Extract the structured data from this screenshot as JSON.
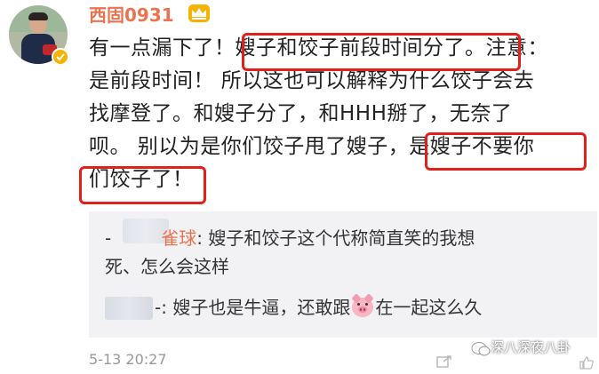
{
  "post": {
    "username": "西固0931",
    "lines": [
      "有一点漏下了！嫂子和饺子前段时间分了。注意：",
      "是前段时间！ 所以这也可以解释为什么饺子会去",
      "找摩登了。和嫂子分了，和HHH掰了，无奈了",
      "呗。 别以为是你们饺子甩了嫂子，是嫂子不要你",
      "们饺子了！"
    ],
    "timestamp": "5-13 20:27"
  },
  "quote": {
    "reply1_prefix": "-",
    "reply1_name": "雀球",
    "reply1_text": ": 嫂子和饺子这个代称简直笑的我想",
    "reply1_cont": "死、怎么会这样",
    "reply2_prefix": "-:",
    "reply2_text_a": " 嫂子也是牛逼，还敢跟",
    "reply2_text_b": "在一起这么久"
  },
  "watermark": {
    "text": "深八深夜八卦"
  },
  "icons": {
    "crown": "crown-icon",
    "verified": "verified-badge-icon",
    "pig": "pig-emoji-icon",
    "wechat": "wechat-icon"
  },
  "colors": {
    "username": "#eb7350",
    "highlight_border": "#e0201b",
    "quote_bg": "#f2f2f5",
    "timestamp": "#999999"
  }
}
